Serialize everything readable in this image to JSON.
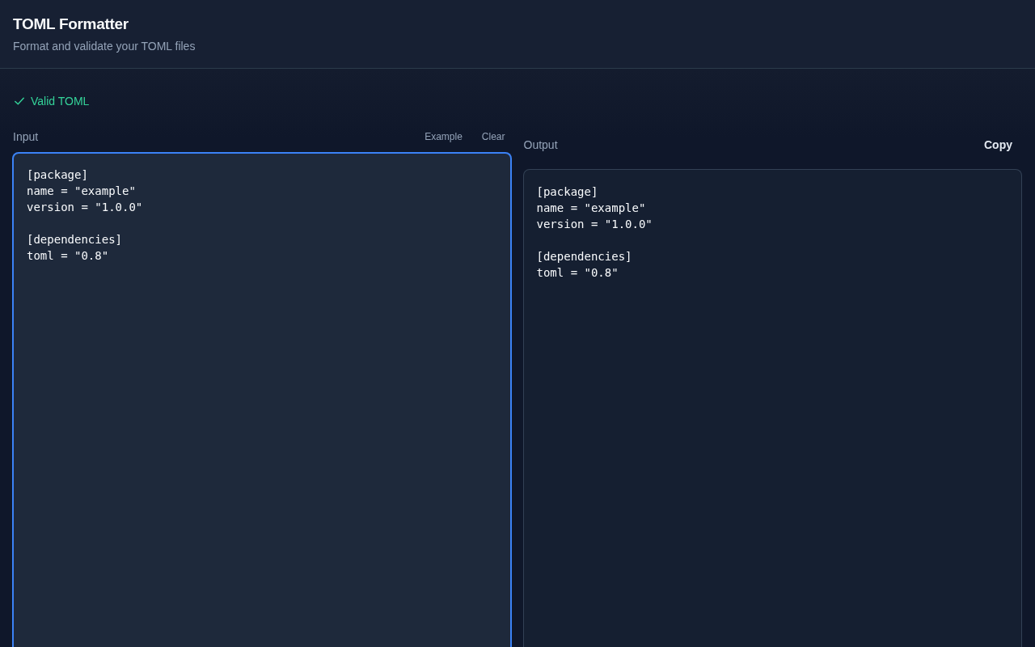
{
  "header": {
    "title": "TOML Formatter",
    "subtitle": "Format and validate your TOML files"
  },
  "status": {
    "valid": true,
    "text": "Valid TOML"
  },
  "input": {
    "label": "Input",
    "buttons": [
      "Example",
      "Clear"
    ],
    "focused": true,
    "value": "[package]\nname = \"example\"\nversion = \"1.0.0\"\n\n[dependencies]\ntoml = \"0.8\""
  },
  "output": {
    "label": "Output",
    "buttons": [
      "Copy"
    ],
    "text": "[package]\nname = \"example\"\nversion = \"1.0.0\"\n\n[dependencies]\ntoml = \"0.8\""
  }
}
